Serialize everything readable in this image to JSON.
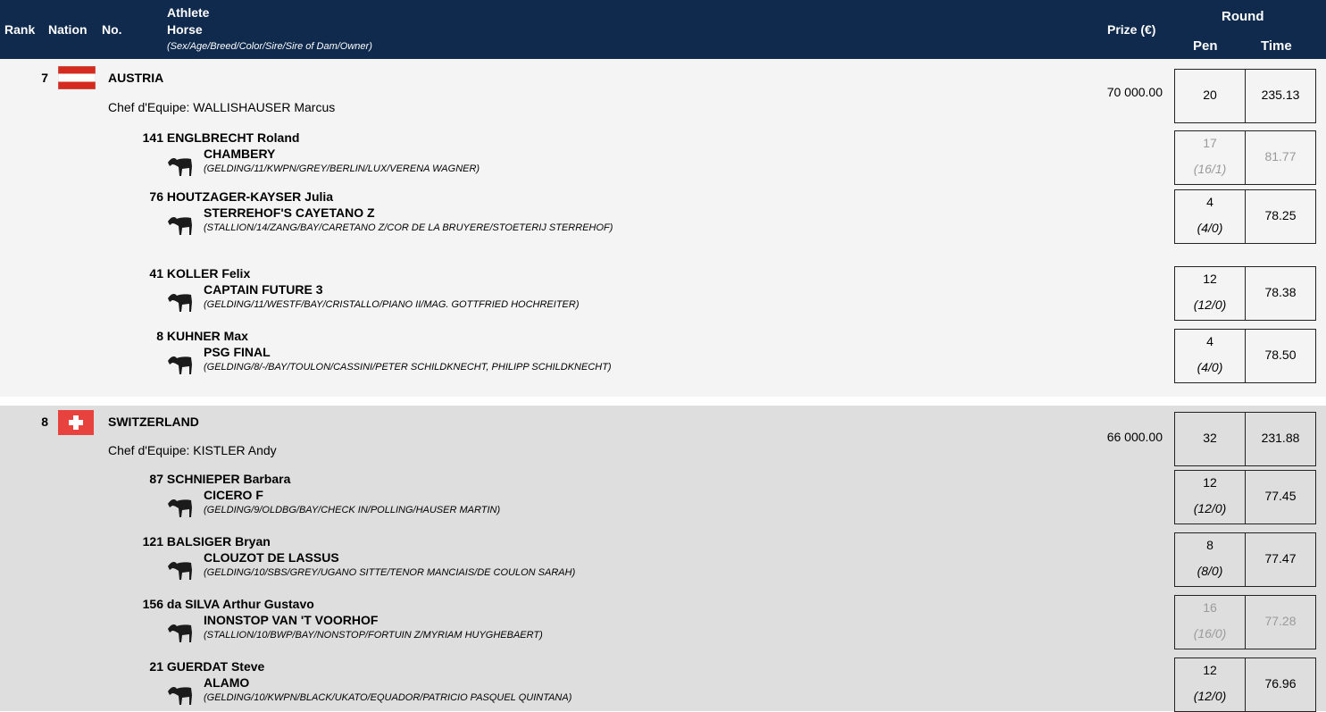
{
  "header": {
    "rank": "Rank",
    "nation": "Nation",
    "no": "No.",
    "athlete": "Athlete",
    "horse": "Horse",
    "horse_detail": "(Sex/Age/Breed/Color/Sire/Sire of Dam/Owner)",
    "prize": "Prize (€)",
    "round": "Round",
    "pen": "Pen",
    "time": "Time"
  },
  "teams": [
    {
      "rank": "7",
      "flag": "austria-flag",
      "nation": "AUSTRIA",
      "chef": "Chef d'Equipe: WALLISHAUSER Marcus",
      "prize": "70 000.00",
      "pen": "20",
      "time": "235.13",
      "riders": [
        {
          "no": "141",
          "name": "ENGLBRECHT Roland",
          "horse": "CHAMBERY",
          "detail": "(GELDING/11/KWPN/GREY/BERLIN/LUX/VERENA WAGNER)",
          "pen": "17",
          "pen_detail": "(16/1)",
          "time": "81.77",
          "dropped": true
        },
        {
          "no": "76",
          "name": "HOUTZAGER-KAYSER Julia",
          "horse": "STERREHOF'S CAYETANO Z",
          "detail": "(STALLION/14/ZANG/BAY/CARETANO Z/COR DE LA BRUYERE/STOETERIJ STERREHOF)",
          "pen": "4",
          "pen_detail": "(4/0)",
          "time": "78.25",
          "dropped": false
        },
        {
          "no": "41",
          "name": "KOLLER Felix",
          "horse": "CAPTAIN FUTURE 3",
          "detail": "(GELDING/11/WESTF/BAY/CRISTALLO/PIANO II/MAG. GOTTFRIED HOCHREITER)",
          "pen": "12",
          "pen_detail": "(12/0)",
          "time": "78.38",
          "dropped": false
        },
        {
          "no": "8",
          "name": "KUHNER Max",
          "horse": "PSG FINAL",
          "detail": "(GELDING/8/-/BAY/TOULON/CASSINI/PETER SCHILDKNECHT, PHILIPP SCHILDKNECHT)",
          "pen": "4",
          "pen_detail": "(4/0)",
          "time": "78.50",
          "dropped": false
        }
      ]
    },
    {
      "rank": "8",
      "flag": "switzerland-flag",
      "nation": "SWITZERLAND",
      "chef": "Chef d'Equipe: KISTLER Andy",
      "prize": "66 000.00",
      "pen": "32",
      "time": "231.88",
      "riders": [
        {
          "no": "87",
          "name": "SCHNIEPER Barbara",
          "horse": "CICERO F",
          "detail": "(GELDING/9/OLDBG/BAY/CHECK IN/POLLING/HAUSER MARTIN)",
          "pen": "12",
          "pen_detail": "(12/0)",
          "time": "77.45",
          "dropped": false
        },
        {
          "no": "121",
          "name": "BALSIGER Bryan",
          "horse": "CLOUZOT DE LASSUS",
          "detail": "(GELDING/10/SBS/GREY/UGANO SITTE/TENOR MANCIAIS/DE COULON SARAH)",
          "pen": "8",
          "pen_detail": "(8/0)",
          "time": "77.47",
          "dropped": false
        },
        {
          "no": "156",
          "name": "da SILVA Arthur Gustavo",
          "horse": "INONSTOP VAN 'T VOORHOF",
          "detail": "(STALLION/10/BWP/BAY/NONSTOP/FORTUIN Z/MYRIAM HUYGHEBAERT)",
          "pen": "16",
          "pen_detail": "(16/0)",
          "time": "77.28",
          "dropped": true
        },
        {
          "no": "21",
          "name": "GUERDAT Steve",
          "horse": "ALAMO",
          "detail": "(GELDING/10/KWPN/BLACK/UKATO/EQUADOR/PATRICIO PASQUEL QUINTANA)",
          "pen": "12",
          "pen_detail": "(12/0)",
          "time": "76.96",
          "dropped": false
        }
      ]
    }
  ]
}
